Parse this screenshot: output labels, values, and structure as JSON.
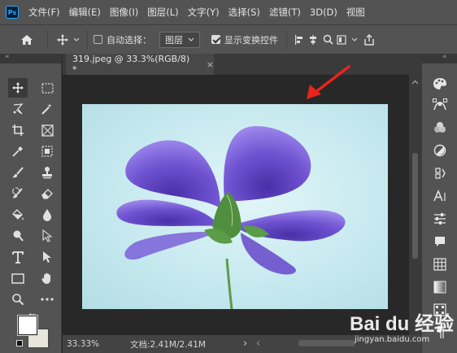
{
  "app": {
    "logo_text": "Ps"
  },
  "menu": [
    "文件(F)",
    "编辑(E)",
    "图像(I)",
    "图层(L)",
    "文字(Y)",
    "选择(S)",
    "滤镜(T)",
    "3D(D)",
    "视图"
  ],
  "options": {
    "auto_select_label": "自动选择：",
    "auto_select_checked": false,
    "auto_select_target": "图层",
    "show_transform_label": "显示变换控件",
    "show_transform_checked": true
  },
  "document": {
    "tab_title": "319.jpeg @ 33.3%(RGB/8) *",
    "close_glyph": "×"
  },
  "status": {
    "zoom": "33.33%",
    "doc_info": "文档:2.41M/2.41M",
    "arrow": "›",
    "scroll_left": "‹"
  },
  "watermark": {
    "logo": "Bai du 经验",
    "url": "jingyan.baidu.com"
  },
  "colors": {
    "foreground": "#ffffff",
    "background": "#e6e6dc",
    "annotation_arrow": "#e8241c",
    "petal": "#6a4fc8"
  }
}
